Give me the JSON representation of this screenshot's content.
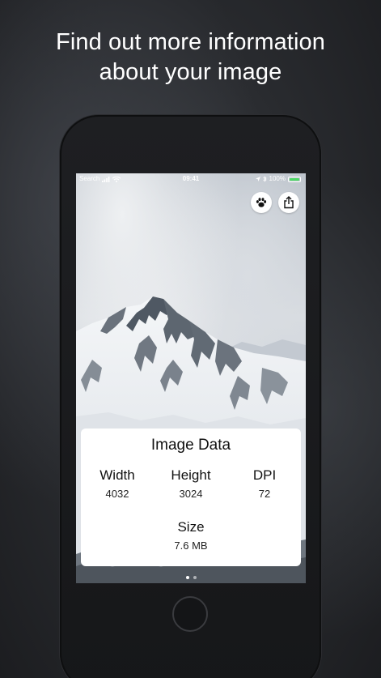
{
  "headline": {
    "line1": "Find out more information",
    "line2": "about your image"
  },
  "statusbar": {
    "back_app": "Search",
    "time": "09:41",
    "battery": "100%"
  },
  "toolbar": {
    "paw_icon": "paw-icon",
    "share_icon": "share-icon"
  },
  "card": {
    "title": "Image Data",
    "width_label": "Width",
    "width_value": "4032",
    "height_label": "Height",
    "height_value": "3024",
    "dpi_label": "DPI",
    "dpi_value": "72",
    "size_label": "Size",
    "size_value": "7.6 MB"
  },
  "colors": {
    "battery": "#4cd964",
    "card_bg": "#ffffff",
    "page_bg": "#2a2c30"
  }
}
